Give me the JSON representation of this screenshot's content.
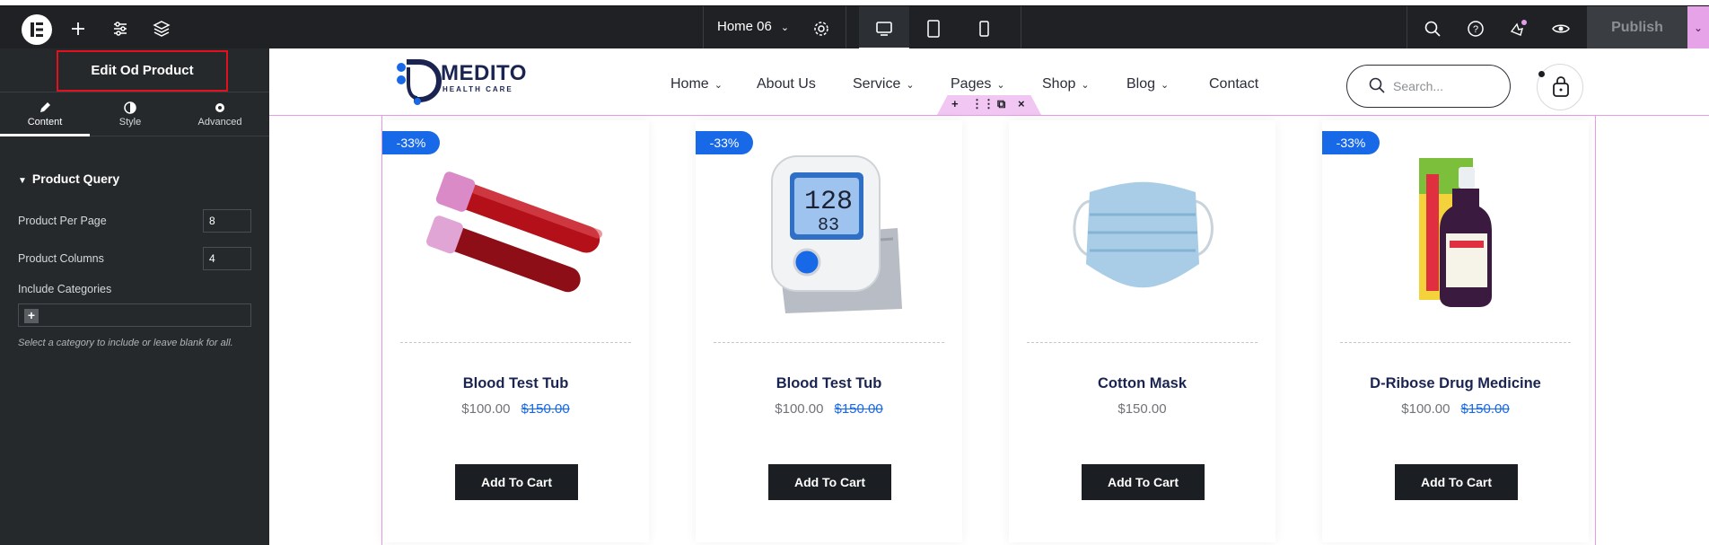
{
  "toolbar": {
    "page_selector": "Home 06",
    "publish_label": "Publish"
  },
  "panel": {
    "title": "Edit Od Product",
    "tabs": [
      {
        "label": "Content",
        "icon": "pencil-icon"
      },
      {
        "label": "Style",
        "icon": "contrast-icon"
      },
      {
        "label": "Advanced",
        "icon": "gear-icon"
      }
    ],
    "section_title": "Product Query",
    "fields": {
      "per_page_label": "Product Per Page",
      "per_page_value": "8",
      "columns_label": "Product Columns",
      "columns_value": "4",
      "categories_label": "Include Categories",
      "categories_hint": "Select a category to include or leave blank for all."
    }
  },
  "site": {
    "brand_name": "MEDITO",
    "brand_sub": "HEALTH CARE",
    "nav": [
      {
        "label": "Home",
        "has_dropdown": true
      },
      {
        "label": "About Us",
        "has_dropdown": false
      },
      {
        "label": "Service",
        "has_dropdown": true
      },
      {
        "label": "Pages",
        "has_dropdown": true
      },
      {
        "label": "Shop",
        "has_dropdown": true
      },
      {
        "label": "Blog",
        "has_dropdown": true
      },
      {
        "label": "Contact",
        "has_dropdown": false
      }
    ],
    "search_placeholder": "Search..."
  },
  "products": [
    {
      "badge": "-33%",
      "name": "Blood Test Tub",
      "price": "$100.00",
      "old_price": "$150.00",
      "button": "Add To Cart",
      "image": "test-tube-image"
    },
    {
      "badge": "-33%",
      "name": "Blood Test Tub",
      "price": "$100.00",
      "old_price": "$150.00",
      "button": "Add To Cart",
      "image": "blood-pressure-monitor-image"
    },
    {
      "badge": "",
      "name": "Cotton Mask",
      "price": "$150.00",
      "old_price": "",
      "button": "Add To Cart",
      "image": "face-mask-image"
    },
    {
      "badge": "-33%",
      "name": "D-Ribose Drug Medicine",
      "price": "$100.00",
      "old_price": "$150.00",
      "button": "Add To Cart",
      "image": "medicine-bottle-image"
    }
  ],
  "colors": {
    "accent": "#1769e8",
    "brand": "#1b2451",
    "editor_bg": "#26292c",
    "highlight": "#e5101e",
    "section_outline": "#e59ce9"
  }
}
